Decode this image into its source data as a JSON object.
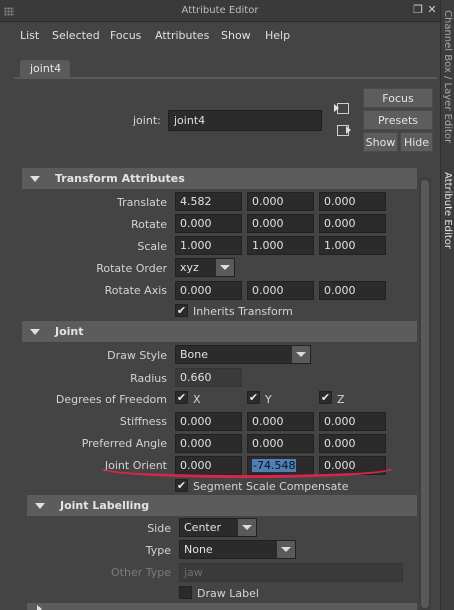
{
  "window": {
    "title": "Attribute Editor"
  },
  "menubar": [
    "List",
    "Selected",
    "Focus",
    "Attributes",
    "Show",
    "Help"
  ],
  "node_tab": "joint4",
  "node_row": {
    "label": "joint:",
    "value": "joint4"
  },
  "buttons": {
    "focus": "Focus",
    "presets": "Presets",
    "show": "Show",
    "hide": "Hide"
  },
  "side_tabs": [
    "Channel Box / Layer Editor",
    "Attribute Editor"
  ],
  "transform": {
    "title": "Transform Attributes",
    "translate": {
      "label": "Translate",
      "values": [
        "4.582",
        "0.000",
        "0.000"
      ]
    },
    "rotate": {
      "label": "Rotate",
      "values": [
        "0.000",
        "0.000",
        "0.000"
      ]
    },
    "scale": {
      "label": "Scale",
      "values": [
        "1.000",
        "1.000",
        "1.000"
      ]
    },
    "rotate_order": {
      "label": "Rotate Order",
      "value": "xyz"
    },
    "rotate_axis": {
      "label": "Rotate Axis",
      "values": [
        "0.000",
        "0.000",
        "0.000"
      ]
    },
    "inherits": {
      "label": "Inherits Transform",
      "checked": true
    }
  },
  "joint": {
    "title": "Joint",
    "draw_style": {
      "label": "Draw Style",
      "value": "Bone"
    },
    "radius": {
      "label": "Radius",
      "value": "0.660"
    },
    "dof": {
      "label": "Degrees of Freedom",
      "axes": [
        "X",
        "Y",
        "Z"
      ]
    },
    "stiffness": {
      "label": "Stiffness",
      "values": [
        "0.000",
        "0.000",
        "0.000"
      ]
    },
    "preferred_angle": {
      "label": "Preferred Angle",
      "values": [
        "0.000",
        "0.000",
        "0.000"
      ]
    },
    "joint_orient": {
      "label": "Joint Orient",
      "values": [
        "0.000",
        "-74.548",
        "0.000"
      ]
    },
    "segment_scale": {
      "label": "Segment Scale Compensate",
      "checked": true
    }
  },
  "labelling": {
    "title": "Joint Labelling",
    "side": {
      "label": "Side",
      "value": "Center"
    },
    "type": {
      "label": "Type",
      "value": "None"
    },
    "other_type": {
      "label": "Other Type",
      "value": "jaw"
    },
    "draw_label": {
      "label": "Draw Label",
      "checked": false
    }
  },
  "colors": {
    "background": "#444444",
    "section": "#5c5c5c",
    "field": "#2b2b2b",
    "selection": "#4e7fb7",
    "annotation": "#d8264a"
  }
}
